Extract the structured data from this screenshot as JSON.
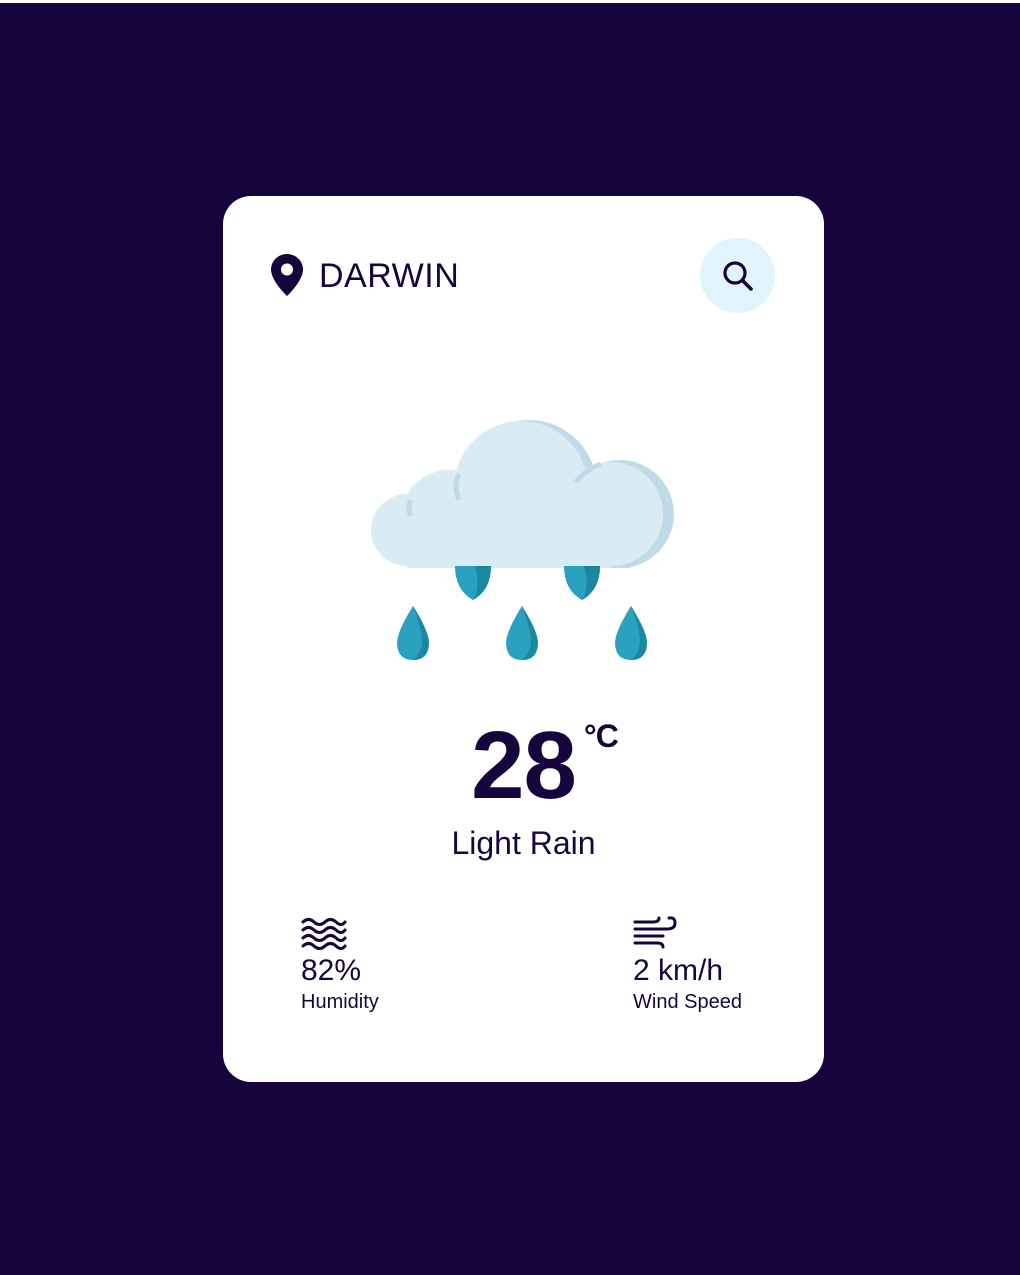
{
  "location": {
    "city": "DARWIN",
    "icon": "map-pin-icon"
  },
  "search": {
    "icon": "search-icon"
  },
  "weather": {
    "icon": "cloud-rain-icon",
    "temperature": "28",
    "unit": "°C",
    "condition": "Light Rain"
  },
  "stats": {
    "humidity": {
      "icon": "waves-icon",
      "value": "82%",
      "label": "Humidity"
    },
    "wind": {
      "icon": "wind-icon",
      "value": "2 km/h",
      "label": "Wind Speed"
    }
  },
  "colors": {
    "background": "#16053d",
    "card": "#ffffff",
    "search_button_bg": "#e1f4fb",
    "cloud_light": "#d9ebf3",
    "cloud_shadow": "#c0dbe8",
    "drop": "#2aa1be",
    "drop_shadow": "#1c87a2"
  }
}
